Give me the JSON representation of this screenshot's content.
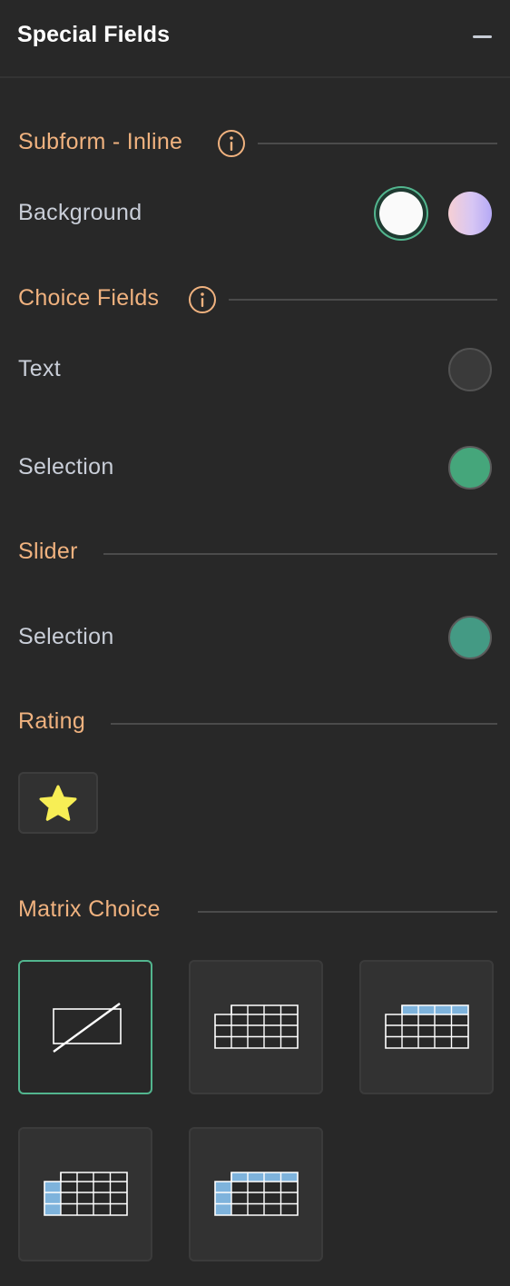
{
  "header": {
    "title": "Special Fields",
    "collapse_icon": "minus-icon"
  },
  "sections": {
    "subform_inline": {
      "title": "Subform - Inline",
      "info_icon": "info-icon",
      "rows": [
        {
          "label": "Background",
          "swatches": [
            {
              "name": "white",
              "color": "#fafafa",
              "selected": true
            },
            {
              "name": "gradient",
              "colors": [
                "#f6cfd4",
                "#d7c6f4",
                "#b5a9f5"
              ],
              "selected": false
            }
          ]
        }
      ]
    },
    "choice_fields": {
      "title": "Choice Fields",
      "info_icon": "info-icon",
      "rows": [
        {
          "label": "Text",
          "color": "#3a3a3a"
        },
        {
          "label": "Selection",
          "color": "#45a67b"
        }
      ]
    },
    "slider": {
      "title": "Slider",
      "rows": [
        {
          "label": "Selection",
          "color": "#449a84"
        }
      ]
    },
    "rating": {
      "title": "Rating",
      "options": [
        {
          "icon": "star-icon",
          "color": "#f7ee55"
        }
      ]
    },
    "matrix_choice": {
      "title": "Matrix Choice",
      "options": [
        {
          "name": "none",
          "icon": "no-style-icon",
          "selected": true
        },
        {
          "name": "plain-grid",
          "icon": "plain-grid-icon",
          "selected": false
        },
        {
          "name": "header-row",
          "icon": "header-row-grid-icon",
          "selected": false
        },
        {
          "name": "header-column",
          "icon": "header-column-grid-icon",
          "selected": false
        },
        {
          "name": "header-row-and-column",
          "icon": "header-row-column-grid-icon",
          "selected": false
        }
      ]
    }
  },
  "colors": {
    "background": "#282828",
    "section_title": "#f0b27f",
    "label": "#c9ced8",
    "accent": "#52b58e",
    "matrix_highlight": "#7eb3dc"
  }
}
